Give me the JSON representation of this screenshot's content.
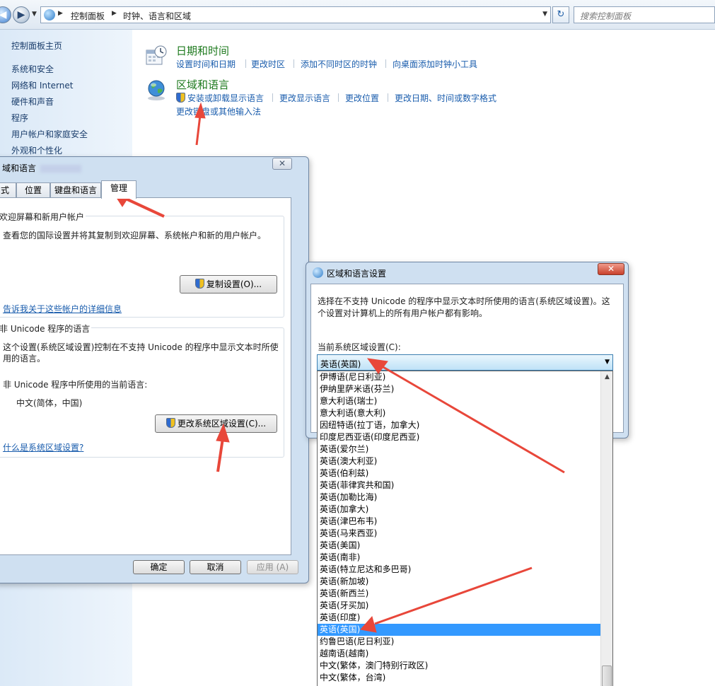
{
  "address_bar": {
    "crumbs": [
      "控制面板",
      "时钟、语言和区域"
    ],
    "search_placeholder": "搜索控制面板"
  },
  "left_nav": {
    "items": [
      "控制面板主页",
      "系统和安全",
      "网络和 Internet",
      "硬件和声音",
      "程序",
      "用户帐户和家庭安全",
      "外观和个性化"
    ]
  },
  "categories": {
    "datetime": {
      "title": "日期和时间",
      "links": [
        "设置时间和日期",
        "更改时区",
        "添加不同时区的时钟",
        "向桌面添加时钟小工具"
      ]
    },
    "region": {
      "title": "区域和语言",
      "links": [
        "安装或卸载显示语言",
        "更改显示语言",
        "更改位置",
        "更改日期、时间或数字格式"
      ],
      "link2": "更改键盘或其他输入法"
    }
  },
  "dialog_region": {
    "title": "域和语言",
    "close": "✕",
    "tabs": [
      "式",
      "位置",
      "键盘和语言",
      "管理"
    ],
    "welcome_group": {
      "legend": "欢迎屏幕和新用户帐户",
      "desc": "查看您的国际设置并将其复制到欢迎屏幕、系统帐户和新的用户帐户。",
      "copy_button": "复制设置(O)...",
      "link": "告诉我关于这些帐户的详细信息"
    },
    "unicode_group": {
      "legend": "非 Unicode 程序的语言",
      "desc1": "这个设置(系统区域设置)控制在不支持 Unicode 的程序中显示文本时所使",
      "desc2": "用的语言。",
      "current_label": "非 Unicode 程序中所使用的当前语言:",
      "current_value": "中文(简体，中国)",
      "change_button": "更改系统区域设置(C)...",
      "link": "什么是系统区域设置?"
    },
    "buttons": {
      "ok": "确定",
      "cancel": "取消",
      "apply": "应用 (A)"
    }
  },
  "dialog_locale": {
    "title": "区域和语言设置",
    "close": "✕",
    "desc1": "选择在不支持 Unicode 的程序中显示文本时所使用的语言(系统区域设置)。这",
    "desc2": "个设置对计算机上的所有用户帐户都有影响。",
    "label": "当前系统区域设置(C):",
    "selected": "英语(英国)",
    "options": [
      "伊博语(尼日利亚)",
      "伊纳里萨米语(芬兰)",
      "意大利语(瑞士)",
      "意大利语(意大利)",
      "因纽特语(拉丁语，加拿大)",
      "印度尼西亚语(印度尼西亚)",
      "英语(爱尔兰)",
      "英语(澳大利亚)",
      "英语(伯利兹)",
      "英语(菲律宾共和国)",
      "英语(加勒比海)",
      "英语(加拿大)",
      "英语(津巴布韦)",
      "英语(马来西亚)",
      "英语(美国)",
      "英语(南非)",
      "英语(特立尼达和多巴哥)",
      "英语(新加坡)",
      "英语(新西兰)",
      "英语(牙买加)",
      "英语(印度)",
      "英语(英国)",
      "约鲁巴语(尼日利亚)",
      "越南语(越南)",
      "中文(繁体，澳门特别行政区)",
      "中文(繁体，台湾)"
    ],
    "highlighted_index": 21
  },
  "colors": {
    "link": "#1a5dad",
    "category_title": "#1e7a1e",
    "selection": "#3399ff",
    "annotation_arrow": "#e8473a"
  }
}
